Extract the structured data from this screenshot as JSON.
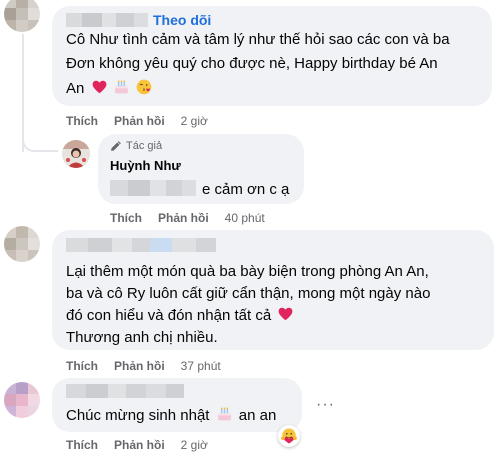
{
  "comments": [
    {
      "follow_label": "Theo dõi",
      "text_line1": "Cô Như tình cảm và tâm lý như thế hỏi sao các con và ba",
      "text_line2_prefix": "Đơn không yêu quý cho được nè, Happy birthday bé An",
      "text_line3": "An",
      "like": "Thích",
      "reply": "Phản hồi",
      "time": "2 giờ"
    },
    {
      "text_line1": "Lại thêm một món quà ba bày biện trong phòng An An,",
      "text_line2": "ba và cô Ry luôn cất giữ cẩn thận, mong một ngày nào",
      "text_line3": "đó con hiểu và đón nhận tất cả",
      "text_line4": "Thương anh chị nhiều.",
      "like": "Thích",
      "reply": "Phản hồi",
      "time": "37 phút"
    },
    {
      "text_prefix": "Chúc mừng sinh nhật",
      "text_suffix": "an an",
      "like": "Thích",
      "reply": "Phản hồi",
      "time": "2 giờ"
    }
  ],
  "reply": {
    "author_tag": "Tác giả",
    "author_name": "Huỳnh Như",
    "text": "e cảm ơn c ạ",
    "like": "Thích",
    "reply": "Phản hồi",
    "time": "40 phút"
  },
  "icons": {
    "pencil": "pencil-icon",
    "heart": "red-heart-emoji",
    "cake": "birthday-cake-emoji",
    "kiss": "face-blowing-kiss-emoji",
    "hug": "hugging-face-emoji",
    "more": "more-options-icon"
  },
  "colors": {
    "link_blue": "#216fdb",
    "bubble_bg": "#f0f2f5",
    "meta_gray": "#65676b",
    "heart_red": "#e0245e"
  }
}
